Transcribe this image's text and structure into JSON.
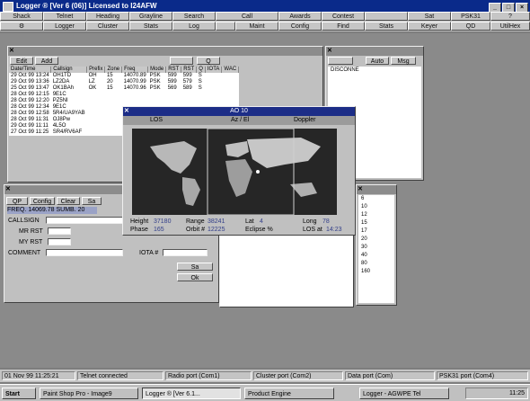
{
  "app": {
    "title": "Logger ® [Ver 6 (06)]  Licensed to I24AFW"
  },
  "toolbar_row1": [
    "Shack",
    "Telnet",
    "Heading",
    "Grayline",
    "Search",
    "Call",
    "Awards",
    "Contest",
    "",
    "Sat",
    "PSK31",
    "?"
  ],
  "toolbar_row2": [
    "⚙",
    "Logger",
    "Cluster",
    "Stats",
    "Log",
    "",
    "Maint",
    "Config",
    "Find",
    "Stats",
    "Keyer",
    "QD",
    "UtilHex"
  ],
  "log_window": {
    "buttons": [
      "Edit",
      "Add",
      "",
      "Q"
    ],
    "columns": [
      "Date/Time",
      "Callsign",
      "Prefix",
      "Zone",
      "Freq",
      "Mode",
      "RST",
      "RST",
      "Q",
      "IOTA",
      "WAC"
    ],
    "rows": [
      [
        "29 Oct 99 13:24",
        "OH1TD",
        "OH",
        "15",
        "14070.89",
        "PSK",
        "599",
        "599",
        "S"
      ],
      [
        "29 Oct 99 13:36",
        "LZ2DA",
        "LZ",
        "20",
        "14070.99",
        "PSK",
        "599",
        "579",
        "S"
      ],
      [
        "25 Oct 99 13:47",
        "OK1BAh",
        "OK",
        "15",
        "14070.96",
        "PSK",
        "569",
        "589",
        "S"
      ],
      [
        "28 Oct 99 12:15",
        "9E1C",
        "",
        "",
        "",
        "",
        "",
        "",
        ""
      ],
      [
        "28 Oct 99 12:20",
        "PZ5NI",
        "",
        "",
        "",
        "",
        "",
        "",
        ""
      ],
      [
        "28 Oct 99 12:34",
        "9E1C",
        "",
        "",
        "",
        "",
        "",
        "",
        ""
      ],
      [
        "28 Oct 99 12:58",
        "5R4/UA9YAB",
        "",
        "",
        "",
        "",
        "",
        "",
        ""
      ],
      [
        "28 Oct 99 11:31",
        "OJ8Pw",
        "",
        "",
        "",
        "",
        "",
        "",
        ""
      ],
      [
        "29 Oct 99 11:11",
        "4L5O",
        "",
        "",
        "",
        "",
        "",
        "",
        ""
      ],
      [
        "27 Oct 99 11:25",
        "SR4/RV6AF",
        "",
        "",
        "",
        "",
        "",
        "",
        ""
      ]
    ]
  },
  "cluster_window": {
    "buttons": [
      "",
      "Auto",
      "Msg"
    ],
    "text": "DISCONNE"
  },
  "entry_window": {
    "buttons": [
      "QP",
      "Config",
      "Clear",
      "Sa"
    ],
    "freq": "FREQ. 14069.78   SUMB. 20",
    "callsign_label": "CALLSIGN",
    "mr_rst_label": "MR RST",
    "my_rst_label": "MY RST",
    "comment_label": "COMMENT",
    "iota_label": "IOTA #",
    "side_buttons": [
      "Sa",
      "Ok"
    ]
  },
  "map_window": {
    "title": "AO 10",
    "los_label": "LOS",
    "az_label": "Az / El",
    "doppler_label": "Doppler",
    "height_label": "Height",
    "height": "37180",
    "range_label": "Range",
    "range": "38241",
    "lat_label": "Lat",
    "lat": "4",
    "long_label": "Long",
    "long": "78",
    "phase_label": "Phase",
    "phase": "165",
    "orbit_label": "Orbit #",
    "orbit": "12225",
    "eclipse_label": "Eclipse %",
    "eclipse": "",
    "los_at_label": "LOS at",
    "los_at": "14:23"
  },
  "band_list": [
    "6",
    "10",
    "12",
    "15",
    "17",
    "20",
    "30",
    "40",
    "80",
    "160"
  ],
  "status": [
    "01 Nov 99 11:25:21",
    "Telnet connected",
    "Radio port (Com1)",
    "Cluster port (Com2)",
    "Data port (Com)",
    "PSK31 port (Com4)"
  ],
  "taskbar": {
    "start": "Start",
    "items": [
      "Paint Shop Pro - Image9",
      "Logger ® [Ver 6.1...",
      "Product Engine",
      "Logger - AGWPE Tel"
    ],
    "clock": "11:25"
  }
}
